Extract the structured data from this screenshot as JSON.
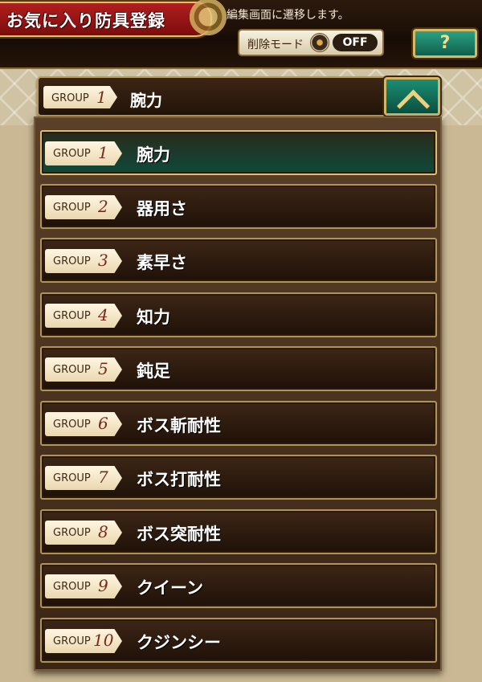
{
  "header": {
    "title": "お気に入り防具登録",
    "notice": "編集画面に遷移します。",
    "delete_mode_label": "削除モード",
    "delete_mode_state": "OFF",
    "help_label": "?"
  },
  "selector": {
    "group_word": "GROUP",
    "group_number": "1",
    "group_name": "腕力"
  },
  "groups": [
    {
      "word": "GROUP",
      "number": "1",
      "name": "腕力",
      "selected": true
    },
    {
      "word": "GROUP",
      "number": "2",
      "name": "器用さ",
      "selected": false
    },
    {
      "word": "GROUP",
      "number": "3",
      "name": "素早さ",
      "selected": false
    },
    {
      "word": "GROUP",
      "number": "4",
      "name": "知力",
      "selected": false
    },
    {
      "word": "GROUP",
      "number": "5",
      "name": "鈍足",
      "selected": false
    },
    {
      "word": "GROUP",
      "number": "6",
      "name": "ボス斬耐性",
      "selected": false
    },
    {
      "word": "GROUP",
      "number": "7",
      "name": "ボス打耐性",
      "selected": false
    },
    {
      "word": "GROUP",
      "number": "8",
      "name": "ボス突耐性",
      "selected": false
    },
    {
      "word": "GROUP",
      "number": "9",
      "name": "クイーン",
      "selected": false
    },
    {
      "word": "GROUP",
      "number": "10",
      "name": "クジンシー",
      "selected": false
    }
  ],
  "colors": {
    "title_red": "#a01616",
    "gold_border": "#d4b565",
    "teal_button": "#168a6f",
    "panel_brown": "#2a170b"
  }
}
